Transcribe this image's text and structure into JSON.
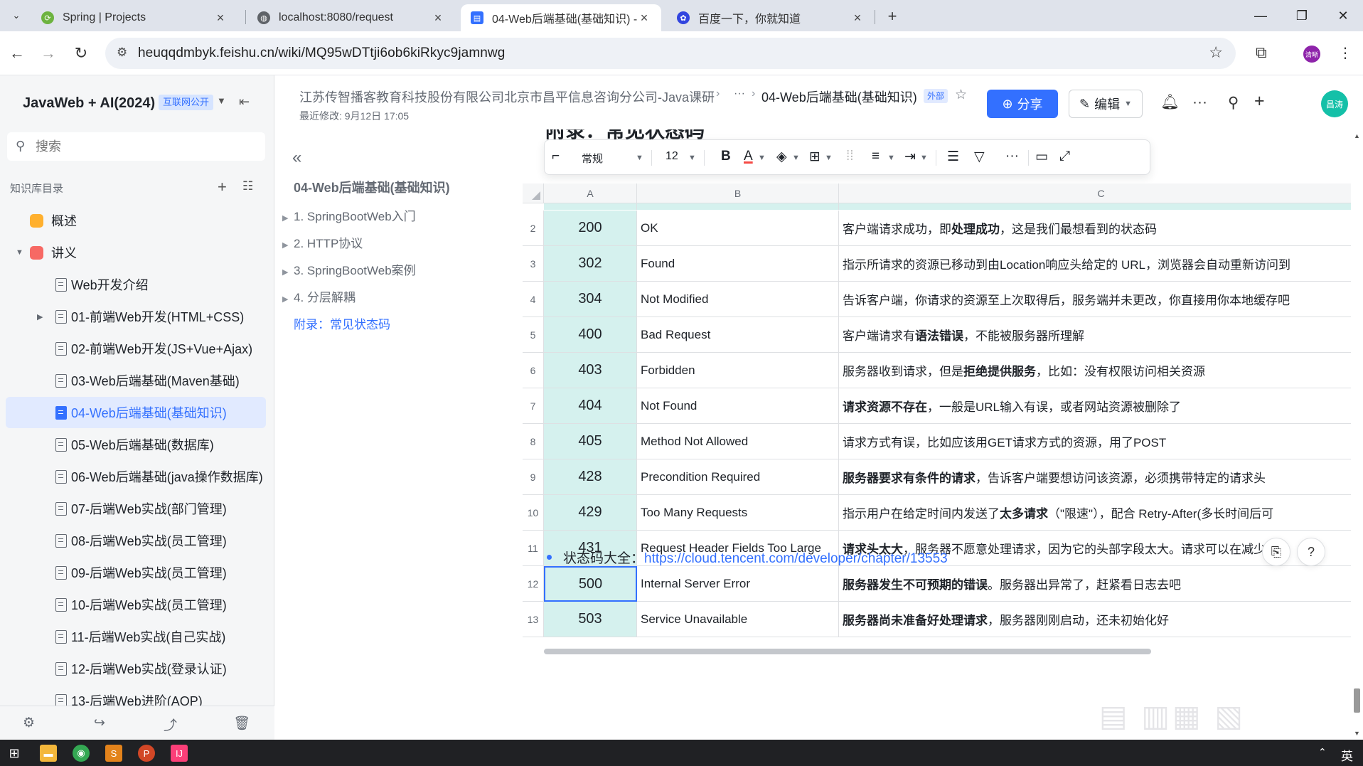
{
  "browser": {
    "tabs": [
      {
        "title": "Spring | Projects",
        "favicon": "spring-icon",
        "color": "#6db33f",
        "active": false
      },
      {
        "title": "localhost:8080/request",
        "favicon": "globe-icon",
        "color": "#5f6368",
        "active": false
      },
      {
        "title": "04-Web后端基础(基础知识) - ",
        "favicon": "doc-icon",
        "color": "#3370ff",
        "active": true
      },
      {
        "title": "百度一下，你就知道",
        "favicon": "baidu-icon",
        "color": "#3245df",
        "active": false
      }
    ],
    "url": "heuqqdmbyk.feishu.cn/wiki/MQ95wDTtji6ob6kiRkyc9jamnwg",
    "profile_label": "清晰"
  },
  "sidebar": {
    "wiki_title": "JavaWeb + AI(2024)",
    "wiki_badge": "互联网公开",
    "search_placeholder": "搜索",
    "toc_heading": "知识库目录",
    "items": [
      {
        "label": "概述",
        "kind": "square",
        "color": "#ffb02e",
        "indent": 0,
        "arrow": ""
      },
      {
        "label": "讲义",
        "kind": "square",
        "color": "#f76964",
        "indent": 0,
        "arrow": "▼"
      },
      {
        "label": "Web开发介绍",
        "kind": "doc",
        "indent": 1,
        "arrow": ""
      },
      {
        "label": "01-前端Web开发(HTML+CSS)",
        "kind": "doc",
        "indent": 1,
        "arrow": "▶"
      },
      {
        "label": "02-前端Web开发(JS+Vue+Ajax)",
        "kind": "doc",
        "indent": 1,
        "arrow": ""
      },
      {
        "label": "03-Web后端基础(Maven基础)",
        "kind": "doc",
        "indent": 1,
        "arrow": ""
      },
      {
        "label": "04-Web后端基础(基础知识)",
        "kind": "doc",
        "indent": 1,
        "arrow": "",
        "active": true
      },
      {
        "label": "05-Web后端基础(数据库)",
        "kind": "doc",
        "indent": 1,
        "arrow": ""
      },
      {
        "label": "06-Web后端基础(java操作数据库)",
        "kind": "doc",
        "indent": 1,
        "arrow": ""
      },
      {
        "label": "07-后端Web实战(部门管理)",
        "kind": "doc",
        "indent": 1,
        "arrow": ""
      },
      {
        "label": "08-后端Web实战(员工管理)",
        "kind": "doc",
        "indent": 1,
        "arrow": ""
      },
      {
        "label": "09-后端Web实战(员工管理)",
        "kind": "doc",
        "indent": 1,
        "arrow": ""
      },
      {
        "label": "10-后端Web实战(员工管理)",
        "kind": "doc",
        "indent": 1,
        "arrow": ""
      },
      {
        "label": "11-后端Web实战(自己实战)",
        "kind": "doc",
        "indent": 1,
        "arrow": ""
      },
      {
        "label": "12-后端Web实战(登录认证)",
        "kind": "doc",
        "indent": 1,
        "arrow": ""
      },
      {
        "label": "13-后端Web进阶(AOP)",
        "kind": "doc",
        "indent": 1,
        "arrow": ""
      }
    ]
  },
  "header": {
    "breadcrumb_root": "江苏传智播客教育科技股份有限公司北京市昌平信息咨询分公司-Java课研",
    "breadcrumb_ellipsis": "···",
    "breadcrumb_current": "04-Web后端基础(基础知识)",
    "external_tag": "外部",
    "last_modified": "最近修改: 9月12日 17:05",
    "share_label": "分享",
    "edit_label": "编辑",
    "avatar_label": "昌涛"
  },
  "outline": {
    "title": "04-Web后端基础(基础知识)",
    "items": [
      {
        "label": "1. SpringBootWeb入门",
        "active": false
      },
      {
        "label": "2. HTTP协议",
        "active": false
      },
      {
        "label": "3. SpringBootWeb案例",
        "active": false
      },
      {
        "label": "4. 分层解耦",
        "active": false
      },
      {
        "label": "附录：常见状态码",
        "active": true
      }
    ]
  },
  "content": {
    "heading_partial": "附录：常见状态码",
    "toolbar": {
      "style": "常规",
      "font_size": "12"
    },
    "columns": [
      "A",
      "B",
      "C"
    ],
    "rows": [
      {
        "n": "2",
        "code": "200",
        "name": "OK",
        "desc": [
          [
            "客户端请求成功，即",
            false
          ],
          [
            "处理成功",
            true
          ],
          [
            "，这是我们最想看到的状态码",
            false
          ]
        ]
      },
      {
        "n": "3",
        "code": "302",
        "name": "Found",
        "desc": [
          [
            "指示所请求的资源已移动到由Location响应头给定的 URL，浏览器会自动重新访问到",
            false
          ]
        ]
      },
      {
        "n": "4",
        "code": "304",
        "name": "Not Modified",
        "desc": [
          [
            "告诉客户端，你请求的资源至上次取得后，服务端并未更改，你直接用你本地缓存吧",
            false
          ]
        ]
      },
      {
        "n": "5",
        "code": "400",
        "name": "Bad Request",
        "desc": [
          [
            "客户端请求有",
            false
          ],
          [
            "语法错误",
            true
          ],
          [
            "，不能被服务器所理解",
            false
          ]
        ]
      },
      {
        "n": "6",
        "code": "403",
        "name": "Forbidden",
        "desc": [
          [
            "服务器收到请求，但是",
            false
          ],
          [
            "拒绝提供服务",
            true
          ],
          [
            "，比如：没有权限访问相关资源",
            false
          ]
        ]
      },
      {
        "n": "7",
        "code": "404",
        "name": "Not Found",
        "desc": [
          [
            "请求资源不存在",
            true
          ],
          [
            "，一般是URL输入有误，或者网站资源被删除了",
            false
          ]
        ]
      },
      {
        "n": "8",
        "code": "405",
        "name": "Method Not Allowed",
        "desc": [
          [
            "请求方式有误，比如应该用GET请求方式的资源，用了POST",
            false
          ]
        ]
      },
      {
        "n": "9",
        "code": "428",
        "name": "Precondition Required",
        "desc": [
          [
            "服务器要求有条件的请求",
            true
          ],
          [
            "，告诉客户端要想访问该资源，必须携带特定的请求头",
            false
          ]
        ]
      },
      {
        "n": "10",
        "code": "429",
        "name": "Too Many Requests",
        "desc": [
          [
            "指示用户在给定时间内发送了",
            false
          ],
          [
            "太多请求",
            true
          ],
          [
            "（\"限速\"），配合 Retry-After(多长时间后可",
            false
          ]
        ]
      },
      {
        "n": "11",
        "code": "431",
        "name": "Request Header Fields Too Large",
        "desc": [
          [
            "请求头太大",
            true
          ],
          [
            "，服务器不愿意处理请求，因为它的头部字段太大。请求可以在减少请",
            false
          ]
        ]
      },
      {
        "n": "12",
        "code": "500",
        "name": "Internal Server Error",
        "selected": true,
        "desc": [
          [
            "服务器发生不可预期的错误",
            true
          ],
          [
            "。服务器出异常了，赶紧看日志去吧",
            false
          ]
        ]
      },
      {
        "n": "13",
        "code": "503",
        "name": "Service Unavailable",
        "desc": [
          [
            "服务器尚未准备好处理请求",
            true
          ],
          [
            "，服务器刚刚启动，还未初始化好",
            false
          ]
        ]
      }
    ],
    "reference_label": "状态码大全：",
    "reference_link": "https://cloud.tencent.com/developer/chapter/13553"
  },
  "taskbar": {
    "ime": "英"
  }
}
